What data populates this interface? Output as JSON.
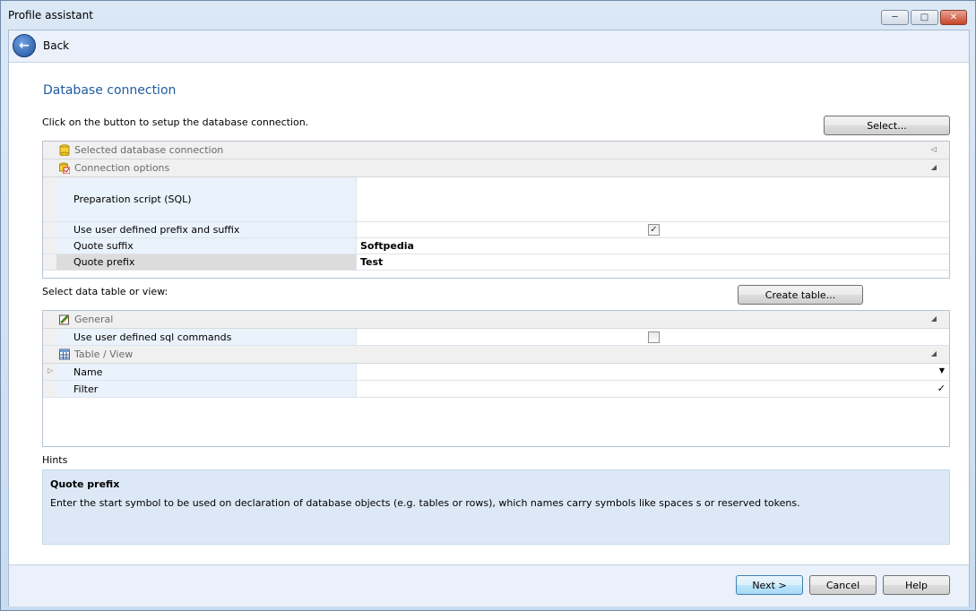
{
  "window": {
    "title": "Profile assistant"
  },
  "nav": {
    "back_label": "Back"
  },
  "page": {
    "heading": "Database connection",
    "instruction": "Click on the button to setup the database connection.",
    "select_button": "Select...",
    "table_instruction": "Select data table or view:",
    "create_table_button": "Create table..."
  },
  "connection_grid": {
    "groups": [
      {
        "label": "Selected database connection"
      },
      {
        "label": "Connection options"
      }
    ],
    "rows": [
      {
        "name": "Preparation script (SQL)",
        "value": ""
      },
      {
        "name": "Use user defined prefix and suffix",
        "checked": true
      },
      {
        "name": "Quote suffix",
        "value": "Softpedia"
      },
      {
        "name": "Quote prefix",
        "value": "Test"
      }
    ]
  },
  "table_grid": {
    "groups": [
      {
        "label": "General"
      },
      {
        "label": "Table / View"
      }
    ],
    "rows": [
      {
        "name": "Use user defined sql commands",
        "checked": false
      },
      {
        "name": "Name",
        "value": ""
      },
      {
        "name": "Filter",
        "value": ""
      }
    ]
  },
  "hints": {
    "label": "Hints",
    "title": "Quote prefix",
    "text": "Enter the start symbol to be used on declaration of database objects (e.g. tables or rows), which names carry symbols like spaces s or reserved tokens."
  },
  "footer": {
    "next": "Next >",
    "cancel": "Cancel",
    "help": "Help"
  },
  "colors": {
    "accent": "#1e5b9f",
    "hint_bg": "#dce8f6"
  }
}
